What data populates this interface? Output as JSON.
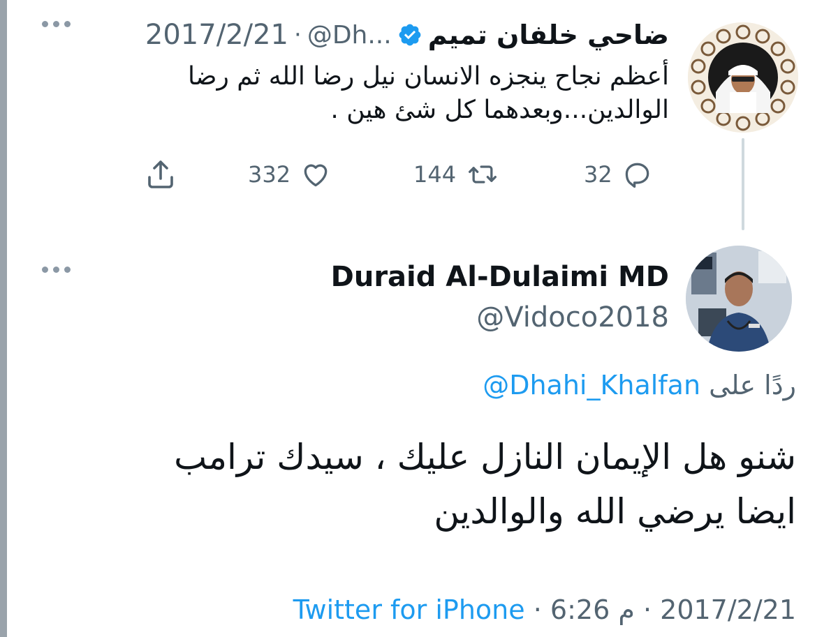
{
  "parent_tweet": {
    "author_name": "ضاحي خلفان تميم",
    "handle": "@Dh...",
    "date": "2017/2/21",
    "separator": "·",
    "text_line1": "أعظم نجاح ينجزه الانسان نيل رضا الله ثم رضا",
    "text_line2": "الوالدين...وبعدهما كل شئ هين .",
    "verified": true,
    "reply_count": "32",
    "retweet_count": "144",
    "like_count": "332",
    "accent_color": "#1d9bf0"
  },
  "reply_tweet": {
    "author_name": "Duraid Al-Dulaimi MD",
    "handle": "@Vidoco2018",
    "replying_prefix": "ردًا على",
    "replying_to": "@Dhahi_Khalfan",
    "text_line1": "شنو هل الإيمان النازل عليك ، سيدك ترامب",
    "text_line2": "ايضا يرضي الله والوالدين",
    "date": "2017/2/21",
    "time": "6:26",
    "ampm": "م",
    "separator": "·",
    "source": "Twitter for iPhone"
  },
  "icons": {
    "more": "more-dots-icon",
    "reply": "reply-icon",
    "retweet": "retweet-icon",
    "like": "heart-icon",
    "share": "share-icon",
    "verified": "verified-badge-icon"
  }
}
